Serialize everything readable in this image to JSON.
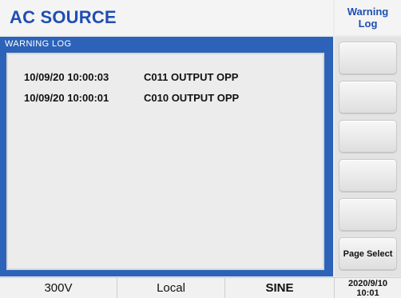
{
  "header": {
    "title": "AC SOURCE",
    "menu_title_line1": "Warning",
    "menu_title_line2": "Log"
  },
  "panel": {
    "title": "WARNING LOG",
    "entries": [
      {
        "timestamp": "10/09/20 10:00:03",
        "message": "C011 OUTPUT OPP"
      },
      {
        "timestamp": "10/09/20 10:00:01",
        "message": "C010 OUTPUT OPP"
      }
    ]
  },
  "softkeys": [
    "",
    "",
    "",
    "",
    "",
    "Page Select"
  ],
  "status": {
    "voltage_range": "300V",
    "control_mode": "Local",
    "waveform": "SINE",
    "date": "2020/9/10",
    "time": "10:01"
  },
  "colors": {
    "accent": "#1f4fb2",
    "panel_header": "#2c63b8"
  }
}
